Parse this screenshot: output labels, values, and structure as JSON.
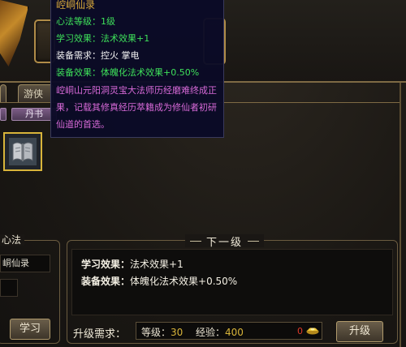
{
  "tooltip": {
    "title": "崆峒仙录",
    "level": "心法等级：1级",
    "learn_effect": "学习效果：法术效果+1",
    "equip_req": "装备需求：控火  掌电",
    "equip_effect": "装备效果：体魄化法术效果+0.50%",
    "description": "崆峒山元阳洞灵宝大法师历经磨难终成正果，记载其修真经历萃籍成为修仙者初研仙道的首选。"
  },
  "tabs": [
    "",
    "游侠"
  ],
  "filters": [
    "",
    "丹书"
  ],
  "skill_slot": {
    "icon": "scroll-book-icon"
  },
  "current": {
    "title": "心法",
    "name": "峒仙录",
    "learn_label": "学习"
  },
  "next": {
    "title": "下一级",
    "learn_label": "学习效果：",
    "learn_value": "法术效果+1",
    "equip_label": "装备效果：",
    "equip_value": "体魄化法术效果+0.50%"
  },
  "requirements": {
    "label": "升级需求：",
    "level_label": "等级：",
    "level_value": "30",
    "exp_label": "经验：",
    "exp_value": "400",
    "money_value": "0",
    "money_icon": "gold-ingot-icon"
  },
  "upgrade_label": "升级",
  "colors": {
    "tooltip_title": "#d8a93a",
    "tooltip_green": "#3ee05a",
    "tooltip_desc": "#d86ad8",
    "value_yellow": "#d8b43a",
    "value_red": "#e03a2a",
    "slot_border": "#d8b43a"
  }
}
